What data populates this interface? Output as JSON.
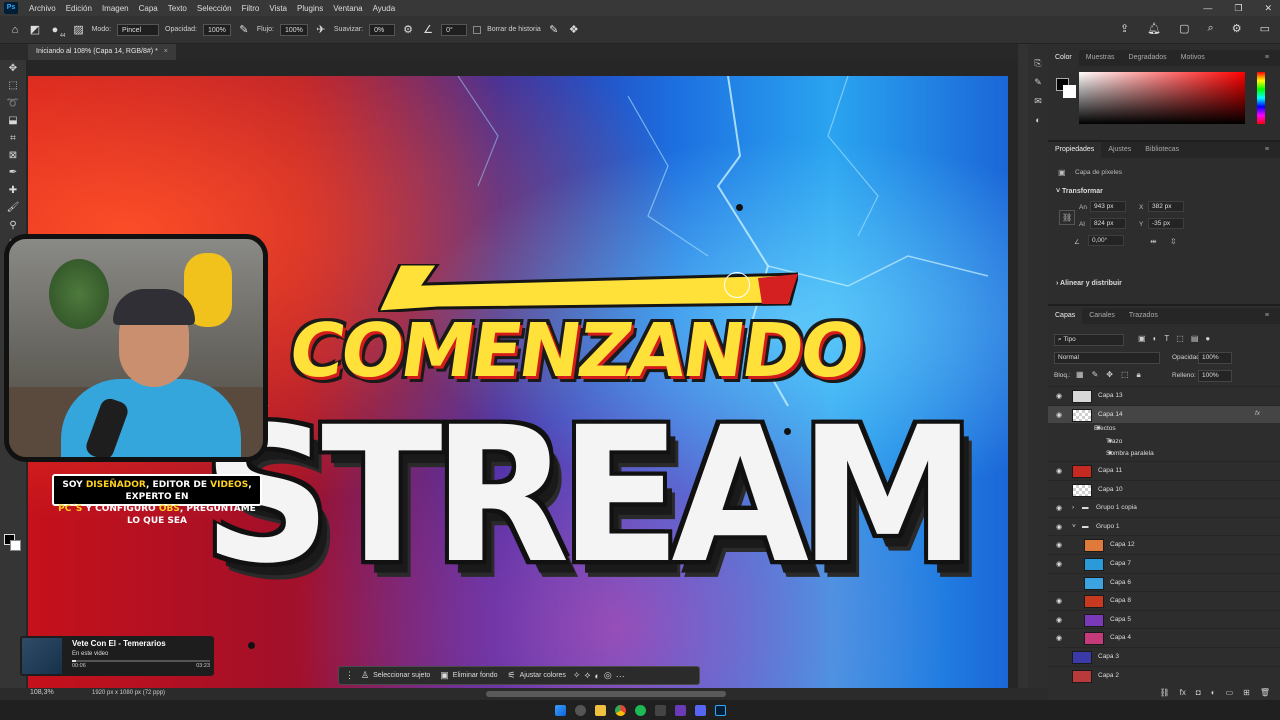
{
  "menu": {
    "items": [
      "Archivo",
      "Edición",
      "Imagen",
      "Capa",
      "Texto",
      "Selección",
      "Filtro",
      "Vista",
      "Plugins",
      "Ventana",
      "Ayuda"
    ]
  },
  "options": {
    "size": "44",
    "mode_label": "Modo:",
    "mode_value": "Pincel",
    "opacity_label": "Opacidad:",
    "opacity_value": "100%",
    "flow_label": "Flujo:",
    "flow_value": "100%",
    "smooth_label": "Suavizar:",
    "smooth_value": "0%",
    "angle_value": "0°",
    "erase_history": "Borrar de historia"
  },
  "document": {
    "tab_title": "Iniciando al 108% (Capa 14, RGB/8#) *",
    "zoom": "108,3%",
    "info": "1920 px x 1080 px (72 ppp)"
  },
  "artwork": {
    "line1": "COMENZANDO",
    "line2": "STREAM"
  },
  "overlay": {
    "caption_parts": [
      "SOY ",
      "DISEÑADOR",
      ", EDITOR DE ",
      "VIDEOS",
      ", EXPERTO EN ",
      "PC´S",
      " Y CONFIGURO ",
      "OBS",
      ", PREGUNTAME LO QUE SEA"
    ],
    "video_card": {
      "title": "Vete Con El - Temerarios",
      "subtitle": "En este video",
      "time_current": "00:06",
      "time_total": "03:23",
      "progress": 0.03
    }
  },
  "context_bar": {
    "select_subject": "Seleccionar sujeto",
    "remove_bg": "Eliminar fondo",
    "adjust_colors": "Ajustar colores"
  },
  "color_panel": {
    "tabs": [
      "Color",
      "Muestras",
      "Degradados",
      "Motivos"
    ],
    "foreground": "#000000",
    "background": "#ffffff",
    "hue": "#ff0000"
  },
  "properties": {
    "tabs": [
      "Propiedades",
      "Ajustes",
      "Bibliotecas"
    ],
    "kind": "Capa de píxeles",
    "transform_title": "Transformar",
    "w_label": "An",
    "w": "943 px",
    "x_label": "X",
    "x": "382 px",
    "h_label": "Al",
    "h": "824 px",
    "y_label": "Y",
    "y": "-35 px",
    "angle": "0,00°",
    "align_title": "Alinear y distribuir"
  },
  "layers_panel": {
    "tabs": [
      "Capas",
      "Canales",
      "Trazados"
    ],
    "filter": "Tipo",
    "blend": "Normal",
    "opacity_label": "Opacidad:",
    "opacity": "100%",
    "lock_label": "Bloq.:",
    "fill_label": "Relleno:",
    "fill": "100%",
    "layers": [
      {
        "name": "Capa 13",
        "visible": true,
        "indent": 0,
        "thumb": "#d8d8d8"
      },
      {
        "name": "Capa 14",
        "visible": true,
        "indent": 0,
        "selected": true,
        "fx": "fx",
        "thumb": "checker"
      },
      {
        "name": "Efectos",
        "visible": true,
        "indent": 1,
        "sub": true
      },
      {
        "name": "Trazo",
        "visible": true,
        "indent": 2,
        "sub": true
      },
      {
        "name": "Sombra paralela",
        "visible": true,
        "indent": 2,
        "sub": true
      },
      {
        "name": "Capa 11",
        "visible": true,
        "indent": 0,
        "thumb": "#c42a22"
      },
      {
        "name": "Capa 10",
        "visible": false,
        "indent": 0,
        "thumb": "checker"
      },
      {
        "name": "Grupo 1 copia",
        "visible": true,
        "indent": 0,
        "group": true,
        "arrow": "›"
      },
      {
        "name": "Grupo 1",
        "visible": true,
        "indent": 0,
        "group": true,
        "arrow": "˅"
      },
      {
        "name": "Capa 12",
        "visible": true,
        "indent": 1,
        "thumb": "#e07a3a"
      },
      {
        "name": "Capa 7",
        "visible": true,
        "indent": 1,
        "thumb": "#2a9bd8"
      },
      {
        "name": "Capa 6",
        "visible": false,
        "indent": 1,
        "thumb": "#3aa3e0"
      },
      {
        "name": "Capa 8",
        "visible": true,
        "indent": 1,
        "thumb": "#c83a1f"
      },
      {
        "name": "Capa 5",
        "visible": true,
        "indent": 1,
        "thumb": "#7a3ab8"
      },
      {
        "name": "Capa 4",
        "visible": true,
        "indent": 1,
        "thumb": "#c43a7a"
      },
      {
        "name": "Capa 3",
        "visible": false,
        "indent": 0,
        "thumb": "#3a3aa8"
      },
      {
        "name": "Capa 2",
        "visible": false,
        "indent": 0,
        "thumb": "#b83a3a"
      }
    ]
  }
}
